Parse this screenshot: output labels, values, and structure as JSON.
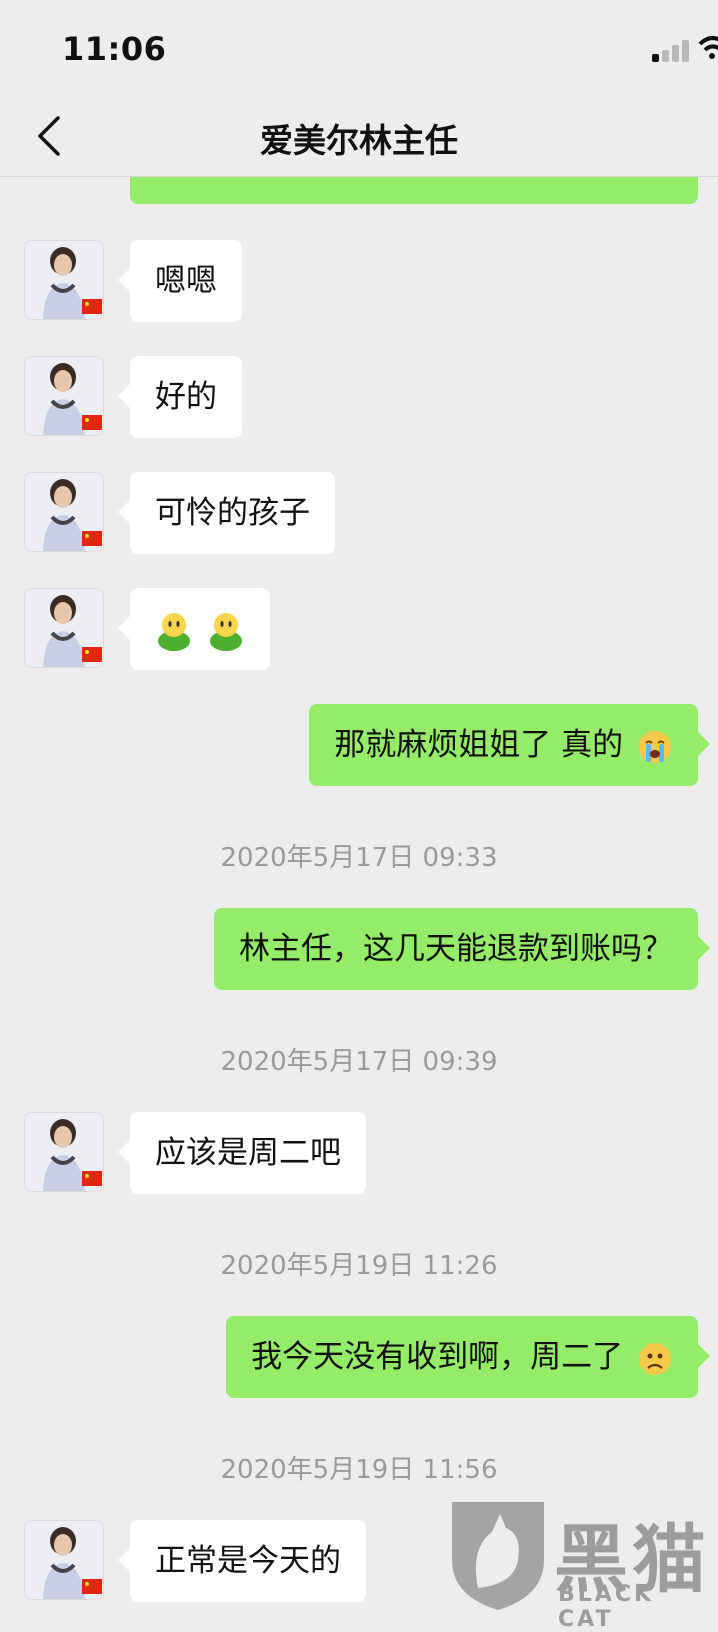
{
  "status_bar": {
    "time": "11:06"
  },
  "header": {
    "title": "爱美尔林主任"
  },
  "messages": [
    {
      "type": "text",
      "from": "contact",
      "text": "嗯嗯"
    },
    {
      "type": "text",
      "from": "contact",
      "text": "好的"
    },
    {
      "type": "text",
      "from": "contact",
      "text": "可怜的孩子"
    },
    {
      "type": "emoji",
      "from": "contact",
      "emojis": [
        "green-figure-emoji",
        "green-figure-emoji"
      ]
    },
    {
      "type": "text",
      "from": "me",
      "text": "那就麻烦姐姐了 真的",
      "emoji": "crying-face-emoji"
    },
    {
      "type": "timestamp",
      "text": "2020年5月17日 09:33"
    },
    {
      "type": "text",
      "from": "me",
      "text": "林主任，这几天能退款到账吗？"
    },
    {
      "type": "timestamp",
      "text": "2020年5月17日 09:39"
    },
    {
      "type": "text",
      "from": "contact",
      "text": "应该是周二吧"
    },
    {
      "type": "timestamp",
      "text": "2020年5月19日 11:26"
    },
    {
      "type": "text",
      "from": "me",
      "text": "我今天没有收到啊，周二了",
      "emoji": "frowning-face-emoji"
    },
    {
      "type": "timestamp",
      "text": "2020年5月19日 11:56"
    },
    {
      "type": "text",
      "from": "contact",
      "text": "正常是今天的"
    }
  ],
  "watermark": {
    "cn": "黑猫",
    "en": "BLACK CAT"
  },
  "colors": {
    "background": "#ededed",
    "incoming_bubble": "#ffffff",
    "outgoing_bubble": "#95ec69",
    "timestamp": "#9a9a9a"
  }
}
